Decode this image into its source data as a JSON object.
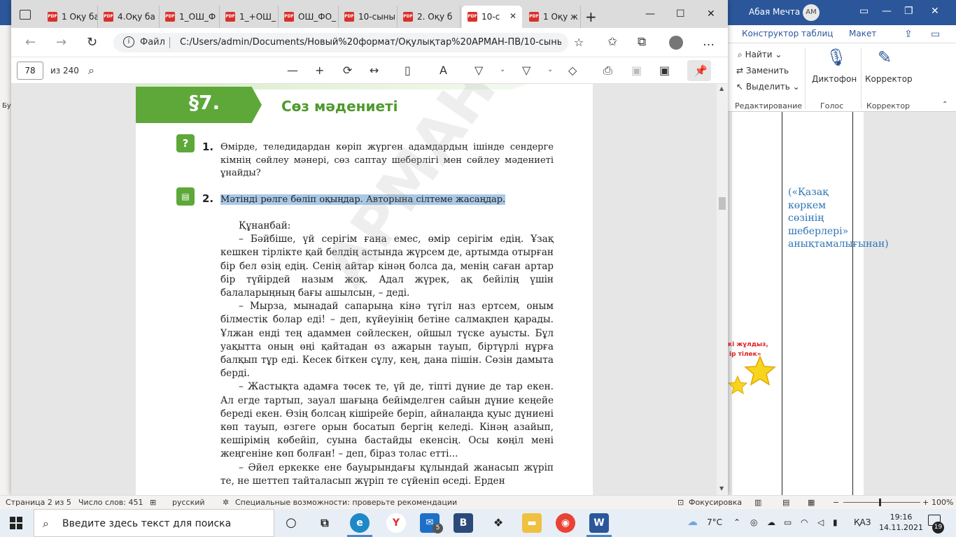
{
  "word": {
    "user_name": "Абая Мечта",
    "user_initials": "AM",
    "ribbon_tabs": [
      "Конструктор таблиц",
      "Макет"
    ],
    "ribbon": {
      "find": "Найти",
      "replace": "Заменить",
      "select": "Выделить",
      "dictate": "Диктофон",
      "editor": "Корректор",
      "group_editing": "Редактирование",
      "group_voice": "Голос",
      "group_editor": "Корректор"
    },
    "left_label": "Бус",
    "note_text": "(«Қазақ көркем сөзінің шеберлері» анықтамалығынан)",
    "red_text_1": "кі жұлдыз,",
    "red_text_2": "ір тілек»"
  },
  "edge": {
    "tabs": [
      {
        "label": "1 Оқу ба",
        "active": false
      },
      {
        "label": "4.Оқу ба",
        "active": false
      },
      {
        "label": "1_ОШ_Ф",
        "active": false
      },
      {
        "label": "1_+ОШ_",
        "active": false
      },
      {
        "label": "ОШ_ФО_",
        "active": false
      },
      {
        "label": "10-сыны",
        "active": false
      },
      {
        "label": "2. Оқу б",
        "active": false
      },
      {
        "label": "10-с",
        "active": true
      },
      {
        "label": "1 Оқу ж",
        "active": false
      }
    ],
    "url_scheme": "Файл",
    "url": "C:/Users/admin/Documents/Новый%20формат/Оқулықтар%20АРМАН-ПВ/10-сыны...",
    "pdf_toolbar": {
      "page_current": "78",
      "page_total": "из 240"
    }
  },
  "pdf_page": {
    "section_number": "§7.",
    "section_title": "Сөз мәдениеті",
    "tasks": [
      {
        "number": "1.",
        "text": "Өмірде, теледидардан көріп жүрген адамдардың ішінде сендерге кімнің сөйлеу мәнері, сөз саптау шеберлігі мен сөйлеу мәдениеті ұнайды?"
      },
      {
        "number": "2.",
        "text": "Мәтінді рөлге бөліп оқыңдар. Авторына сілтеме жасаңдар."
      }
    ],
    "speaker": "Құнанбай:",
    "paragraphs": [
      "– Бәйбіше, үй серігім ғана емес, өмір серігім едің. Ұзақ кешкен тірлікте қай белдің астында жүрсем де, артымда отырған бір бел өзің едің. Сенің айтар кінәң болса да, менің саған артар бір түйірдей назым жоқ. Адал жүрек, ақ бейілің үшін балаларыңның бағы ашылсын, – деді.",
      "– Мырза, мынадай сапарыңа кінә түгіл наз ертсем, оным білместік болар еді! – деп, күйеуінің бетіне салмақпен қарады. Ұлжан енді тең адаммен сөйлескен, ойшыл түске ауысты. Бұл уақытта оның өңі қайтадан өз ажарын тауып, біртүрлі нұрға балқып тұр еді. Кесек біткен сұлу, кең, дана пішін. Сөзін дамыта берді.",
      "– Жастықта адамға төсек те, үй де, тіпті дүние де тар екен. Ал егде тартып, зауал шағыңа бейімделген сайын дүние кеңейе береді екен. Өзің болсаң кішірейе беріп, айналаңда қуыс дүниені көп тауып, өзгеге орын босатып бергің келеді. Кінәң азайып, кешірімің көбейіп, суына бастайды екенсің. Осы көңіл мені жеңгеніне көп болған! – деп, біраз толас етті...",
      "– Әйел еркекке ене бауырындағы құлындай жанасып жүріп те, не шеттеп тайталасып жүріп те сүйеніп өседі. Ерден"
    ],
    "watermark": "АРМАН-ПВ баспасы"
  },
  "statusbar": {
    "page": "Страница 2 из 5",
    "words": "Число слов: 451",
    "language": "русский",
    "accessibility": "Специальные возможности: проверьте рекомендации",
    "focus": "Фокусировка",
    "zoom_minus": "−",
    "zoom_plus": "+",
    "zoom": "100%"
  },
  "taskbar": {
    "search_placeholder": "Введите здесь текст для поиска",
    "mail_badge": "5",
    "weather": "7°C",
    "language": "ҚАЗ",
    "time": "19:16",
    "date": "14.11.2021",
    "notification_count": "19"
  }
}
